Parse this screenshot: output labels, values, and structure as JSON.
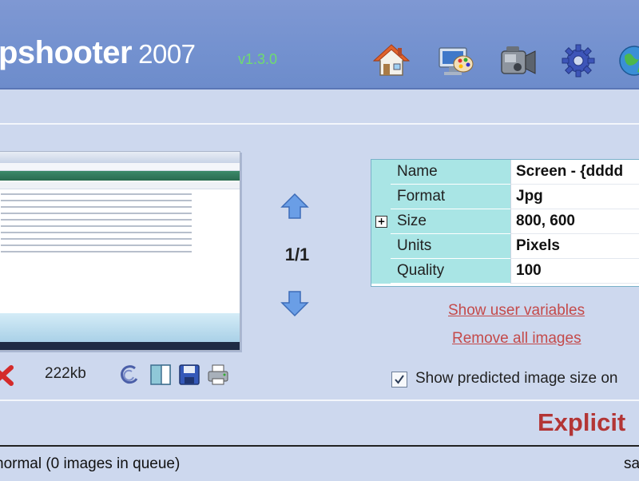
{
  "header": {
    "title_main": "pshooter",
    "title_year": "2007",
    "version": "v1.3.0",
    "toolbar": [
      {
        "name": "home-icon"
      },
      {
        "name": "display-properties-icon"
      },
      {
        "name": "camcorder-icon"
      },
      {
        "name": "gear-icon"
      },
      {
        "name": "globe-icon"
      }
    ]
  },
  "preview": {
    "counter": "1/1",
    "file_size": "222kb"
  },
  "properties": {
    "rows": [
      {
        "name": "Name",
        "value": "Screen - {dddd"
      },
      {
        "name": "Format",
        "value": "Jpg"
      },
      {
        "name": "Size",
        "value": "800, 600"
      },
      {
        "name": "Units",
        "value": "Pixels"
      },
      {
        "name": "Quality",
        "value": "100"
      }
    ]
  },
  "links": {
    "show_user_variables": "Show user variables",
    "remove_all_images": "Remove all images"
  },
  "options": {
    "show_predicted_size_label": "Show predicted image size on",
    "show_predicted_size_checked": true
  },
  "mode": {
    "label": "Explicit"
  },
  "statusbar": {
    "text": "normal  (0 images in queue)",
    "right": "sa"
  },
  "colors": {
    "header_bg": "#7391cf",
    "page_bg": "#cdd8ee",
    "property_name_bg": "#a9e5e5",
    "link": "#c44a4a",
    "mode_label": "#b33535",
    "version": "#6fdc6f"
  }
}
